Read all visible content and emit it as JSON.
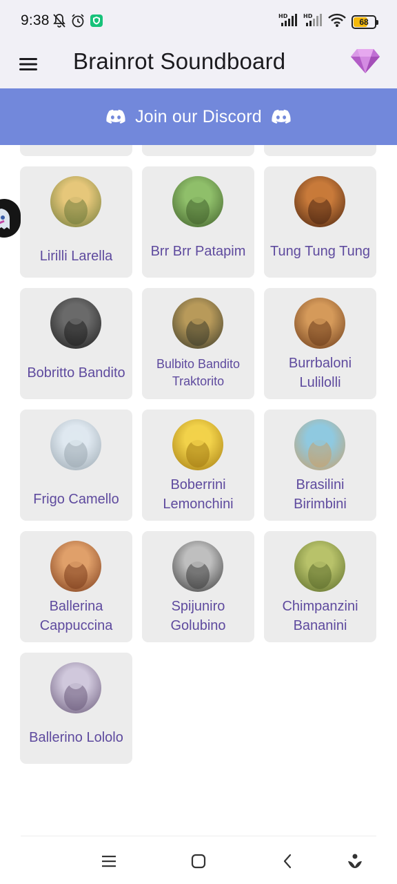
{
  "status_bar": {
    "time": "9:38",
    "battery_level": "68",
    "battery_fill_fraction": 0.68,
    "icons": [
      "mute-bell-icon",
      "alarm-icon",
      "vpn-shield-icon",
      "hd-signal-icon",
      "hd-signal-icon",
      "wifi-icon",
      "battery-icon"
    ]
  },
  "app_bar": {
    "title": "Brainrot Soundboard",
    "menu_icon": "hamburger-menu-icon",
    "premium_icon": "diamond-gem-icon"
  },
  "discord_banner": {
    "label": "Join our Discord",
    "icon": "discord-icon"
  },
  "sounds": [
    {
      "name": "",
      "avatar": [
        "#c9b27a",
        "#6b5a3a"
      ]
    },
    {
      "name": "",
      "avatar": [
        "#a9c9a0",
        "#4d6a3c"
      ]
    },
    {
      "name": "",
      "avatar": [
        "#c28a4a",
        "#5a3417"
      ]
    },
    {
      "name": "Lirilli Larella",
      "avatar": [
        "#e6c77a",
        "#6e7a3a"
      ]
    },
    {
      "name": "Brr Brr Patapim",
      "avatar": [
        "#8fbf6a",
        "#3f5e2a"
      ]
    },
    {
      "name": "Tung Tung Tung",
      "avatar": [
        "#c87a3a",
        "#4a2410"
      ]
    },
    {
      "name": "Bobritto Bandito",
      "avatar": [
        "#6a6a6a",
        "#1e1e1e"
      ]
    },
    {
      "name": "Bulbito Bandito Traktorito",
      "avatar": [
        "#b89a5a",
        "#3a3a2a"
      ]
    },
    {
      "name": "Burrbaloni Lulilolli",
      "avatar": [
        "#d59a5a",
        "#6a3a1a"
      ]
    },
    {
      "name": "Frigo Camello",
      "avatar": [
        "#dfe8f0",
        "#9aa7b0"
      ]
    },
    {
      "name": "Boberrini Lemonchini",
      "avatar": [
        "#f2d24a",
        "#a27a12"
      ]
    },
    {
      "name": "Brasilini Birimbini",
      "avatar": [
        "#8fc9e0",
        "#c9a06a"
      ]
    },
    {
      "name": "Ballerina Cappuccina",
      "avatar": [
        "#e0a06a",
        "#7a3a1a"
      ]
    },
    {
      "name": "Spijuniro Golubino",
      "avatar": [
        "#bfbfbf",
        "#3a3a3a"
      ]
    },
    {
      "name": "Chimpanzini Bananini",
      "avatar": [
        "#b8c26a",
        "#5a6a2a"
      ]
    },
    {
      "name": "Ballerino Lololo",
      "avatar": [
        "#d0c8dc",
        "#6a5a7a"
      ]
    }
  ],
  "nav_bar": {
    "icons": [
      "recents-icon",
      "home-icon",
      "back-icon",
      "assistant-icon"
    ]
  }
}
